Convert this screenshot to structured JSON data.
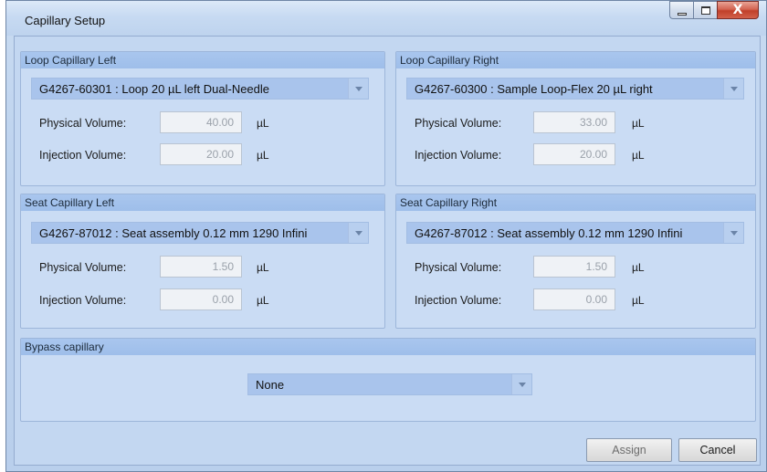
{
  "window": {
    "title": "Capillary Setup",
    "controls": {
      "minimize": "minimize",
      "maximize": "maximize",
      "close": "X"
    }
  },
  "loop_left": {
    "header": "Loop Capillary Left",
    "selection": "G4267-60301 : Loop 20 µL left Dual-Needle",
    "physical_label": "Physical Volume:",
    "physical_value": "40.00",
    "injection_label": "Injection Volume:",
    "injection_value": "20.00",
    "unit": "µL"
  },
  "loop_right": {
    "header": "Loop Capillary Right",
    "selection": "G4267-60300 : Sample Loop-Flex 20 µL right",
    "physical_label": "Physical Volume:",
    "physical_value": "33.00",
    "injection_label": "Injection Volume:",
    "injection_value": "20.00",
    "unit": "µL"
  },
  "seat_left": {
    "header": "Seat Capillary Left",
    "selection": "G4267-87012 : Seat assembly 0.12 mm 1290 Infini",
    "physical_label": "Physical Volume:",
    "physical_value": "1.50",
    "injection_label": "Injection Volume:",
    "injection_value": "0.00",
    "unit": "µL"
  },
  "seat_right": {
    "header": "Seat Capillary Right",
    "selection": "G4267-87012 : Seat assembly 0.12 mm 1290 Infini",
    "physical_label": "Physical Volume:",
    "physical_value": "1.50",
    "injection_label": "Injection Volume:",
    "injection_value": "0.00",
    "unit": "µL"
  },
  "bypass": {
    "header": "Bypass capillary",
    "selection": "None"
  },
  "buttons": {
    "assign": "Assign",
    "cancel": "Cancel"
  }
}
